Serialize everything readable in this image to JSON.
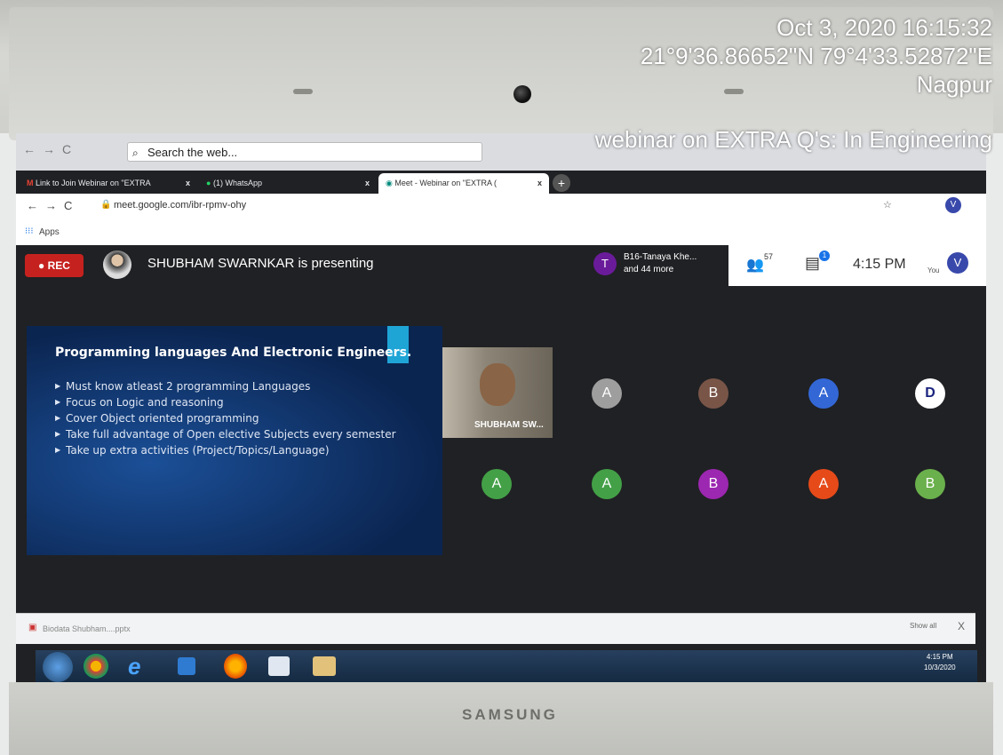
{
  "overlay": {
    "datetime": "Oct 3, 2020 16:15:32",
    "coords": "21°9'36.86652\"N 79°4'33.52872\"E",
    "city": "Nagpur",
    "event": "webinar on EXTRA Q's: In Engineering"
  },
  "laptop": {
    "brand": "SAMSUNG"
  },
  "browser": {
    "search_placeholder": "Search the web...",
    "tabs": [
      {
        "title": "Link to Join Webinar on \"EXTRA",
        "close": "x"
      },
      {
        "title": "(1) WhatsApp",
        "close": "x"
      },
      {
        "title": "Meet - Webinar on \"EXTRA (",
        "close": "x"
      }
    ],
    "url": "meet.google.com/ibr-rpmv-ohy",
    "apps_label": "Apps"
  },
  "meet": {
    "rec_label": "REC",
    "presenting_text": "SHUBHAM SWARNKAR is presenting",
    "participant_chip": {
      "initial": "T",
      "line1": "B16-Tanaya Khe...",
      "line2": "and 44 more"
    },
    "people_count": "57",
    "chat_badge": "1",
    "clock": "4:15 PM",
    "you_label": "You",
    "you_initial": "V",
    "video_tile_name": "SHUBHAM SW...",
    "avatars": [
      {
        "initial": "A",
        "color": "#9e9e9e"
      },
      {
        "initial": "B",
        "color": "#795548"
      },
      {
        "initial": "A",
        "color": "#3367d6"
      },
      {
        "initial": "D",
        "color": "#ffffff"
      },
      {
        "initial": "A",
        "color": "#43a047"
      },
      {
        "initial": "A",
        "color": "#43a047"
      },
      {
        "initial": "B",
        "color": "#9c27b0"
      },
      {
        "initial": "A",
        "color": "#e64a19"
      },
      {
        "initial": "B",
        "color": "#6ab04c"
      }
    ]
  },
  "slide": {
    "title": "Programming languages And Electronic Engineers.",
    "bullets": [
      "Must know atleast 2 programming Languages",
      "Focus on Logic and reasoning",
      "Cover Object oriented programming",
      "Take full advantage of Open elective Subjects every semester",
      "Take up extra activities (Project/Topics/Language)"
    ]
  },
  "download_bar": {
    "file": "Biodata Shubham....pptx",
    "show_all": "Show all",
    "close": "X"
  },
  "taskbar": {
    "time": "4:15 PM",
    "date": "10/3/2020"
  }
}
